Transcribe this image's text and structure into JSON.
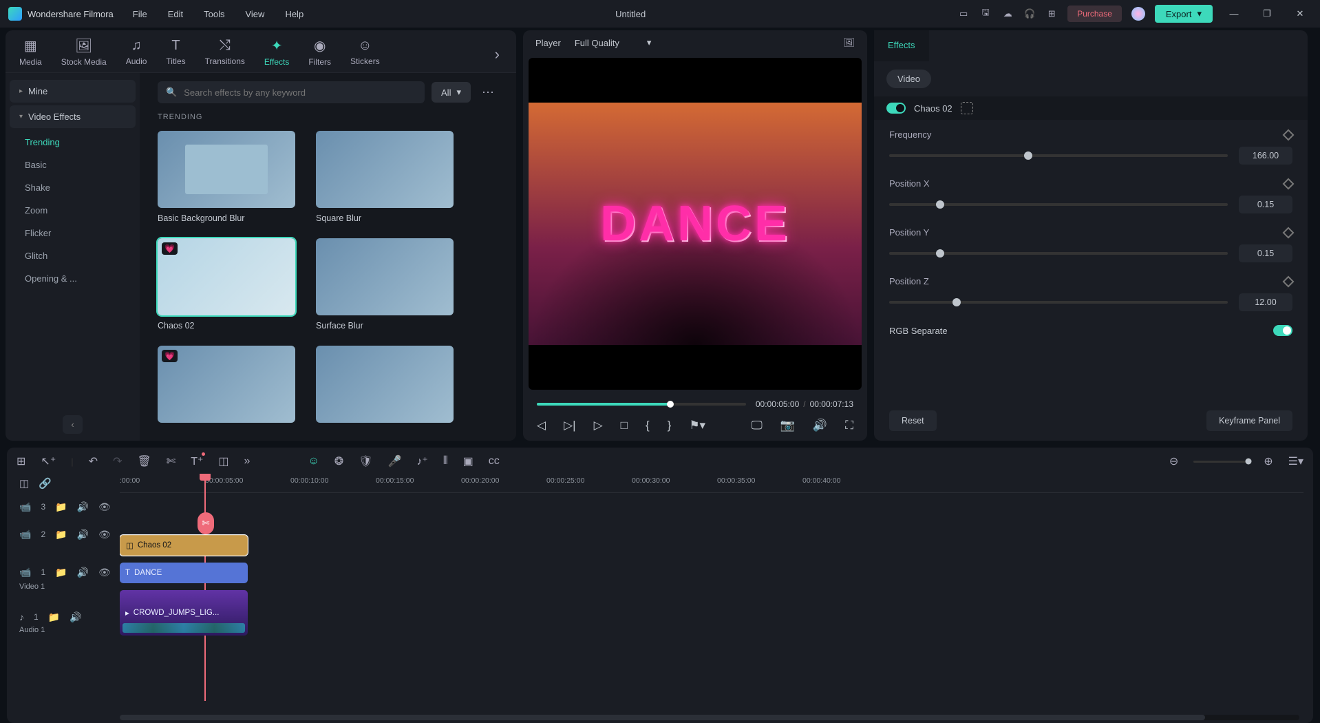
{
  "app": {
    "name": "Wondershare Filmora",
    "document_title": "Untitled"
  },
  "menu": [
    "File",
    "Edit",
    "Tools",
    "View",
    "Help"
  ],
  "titlebar_buttons": {
    "purchase": "Purchase",
    "export": "Export"
  },
  "main_tabs": [
    {
      "label": "Media"
    },
    {
      "label": "Stock Media"
    },
    {
      "label": "Audio"
    },
    {
      "label": "Titles"
    },
    {
      "label": "Transitions"
    },
    {
      "label": "Effects"
    },
    {
      "label": "Filters"
    },
    {
      "label": "Stickers"
    }
  ],
  "sidebar": {
    "top": "Mine",
    "group": "Video Effects",
    "items": [
      "Trending",
      "Basic",
      "Shake",
      "Zoom",
      "Flicker",
      "Glitch",
      "Opening & ..."
    ]
  },
  "browser": {
    "search_placeholder": "Search effects by any keyword",
    "filter": "All",
    "section": "TRENDING",
    "cards": [
      {
        "label": "Basic Background Blur"
      },
      {
        "label": "Square Blur"
      },
      {
        "label": "Chaos 02",
        "selected": true,
        "heart": true
      },
      {
        "label": "Surface Blur"
      },
      {
        "label": "",
        "heart": true
      },
      {
        "label": ""
      }
    ]
  },
  "player": {
    "label": "Player",
    "quality": "Full Quality",
    "overlay_text": "DANCE",
    "current_time": "00:00:05:00",
    "duration": "00:00:07:13"
  },
  "inspector": {
    "tab": "Effects",
    "pill": "Video",
    "effect_name": "Chaos 02",
    "params": [
      {
        "name": "Frequency",
        "value": "166.00",
        "pct": 41
      },
      {
        "name": "Position X",
        "value": "0.15",
        "pct": 15
      },
      {
        "name": "Position Y",
        "value": "0.15",
        "pct": 15
      },
      {
        "name": "Position Z",
        "value": "12.00",
        "pct": 20
      }
    ],
    "rgb_label": "RGB Separate",
    "reset": "Reset",
    "keyframe": "Keyframe Panel"
  },
  "timeline": {
    "ticks": [
      ":00:00",
      "00:00:05:00",
      "00:00:10:00",
      "00:00:15:00",
      "00:00:20:00",
      "00:00:25:00",
      "00:00:30:00",
      "00:00:35:00",
      "00:00:40:00"
    ],
    "tracks": [
      {
        "idx": "3",
        "clip": "Chaos 02",
        "type": "effect"
      },
      {
        "idx": "2",
        "clip": "DANCE",
        "type": "title"
      },
      {
        "idx": "1",
        "clip": "CROWD_JUMPS_LIG...",
        "type": "video",
        "label": "Video 1"
      },
      {
        "idx": "1",
        "type": "audio",
        "label": "Audio 1"
      }
    ]
  }
}
